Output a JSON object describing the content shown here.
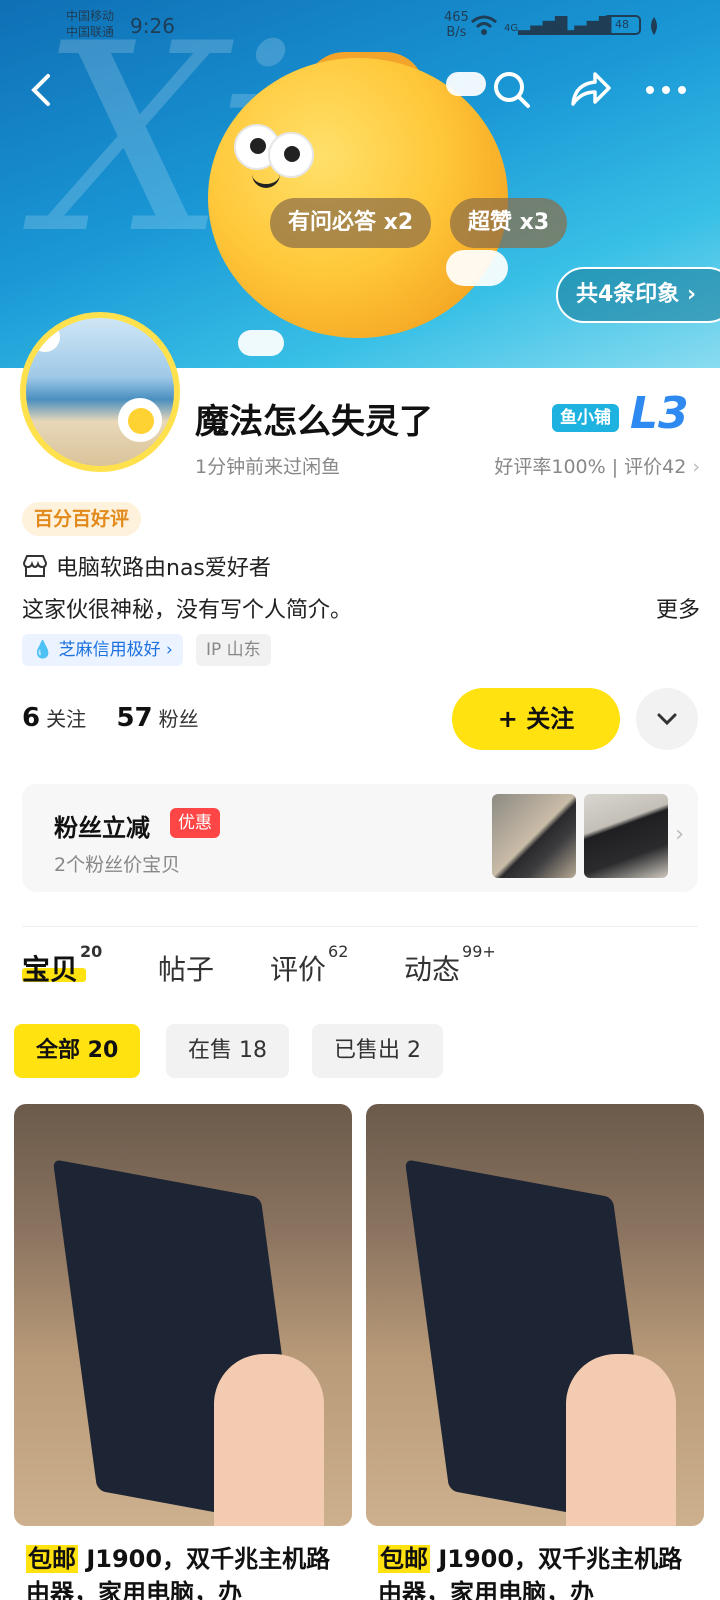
{
  "status_bar": {
    "carrier_1": "中国移动",
    "carrier_2": "中国联通",
    "time": "9:26",
    "speed_value": "465",
    "speed_unit": "B/s",
    "signal_1": "4G",
    "signal_2": "4G",
    "battery": "48"
  },
  "header": {
    "badges": [
      "有问必答 x2",
      "超赞 x3"
    ],
    "impression_link": "共4条印象"
  },
  "profile": {
    "name": "魔法怎么失灵了",
    "last_seen": "1分钟前来过闲鱼",
    "store_tag": "鱼小铺",
    "level": "L3",
    "rating": "好评率100% | 评价42",
    "good_badge": "百分百好评",
    "category": "电脑软路由nas爱好者",
    "bio": "这家伙很神秘，没有写个人简介。",
    "more": "更多",
    "credit": "芝麻信用极好",
    "ip": "IP 山东",
    "following_count": "6",
    "following_label": "关注",
    "fans_count": "57",
    "fans_label": "粉丝",
    "follow_button": "+ 关注"
  },
  "fans_card": {
    "title": "粉丝立减",
    "tag": "优惠",
    "subtitle": "2个粉丝价宝贝"
  },
  "tabs": [
    {
      "label": "宝贝",
      "count": "20"
    },
    {
      "label": "帖子",
      "count": ""
    },
    {
      "label": "评价",
      "count": "62"
    },
    {
      "label": "动态",
      "count": "99+"
    }
  ],
  "filters": [
    "全部 20",
    "在售 18",
    "已售出 2"
  ],
  "products": [
    {
      "tag": "包邮",
      "title": " J1900，双千兆主机路由器，家用电脑，办"
    },
    {
      "tag": "包邮",
      "title": " J1900，双千兆主机路由器，家用电脑，办"
    }
  ],
  "colors": {
    "accent_yellow": "#ffe20f",
    "credit_blue": "#1d72e0",
    "promo_red": "#ff4646"
  }
}
